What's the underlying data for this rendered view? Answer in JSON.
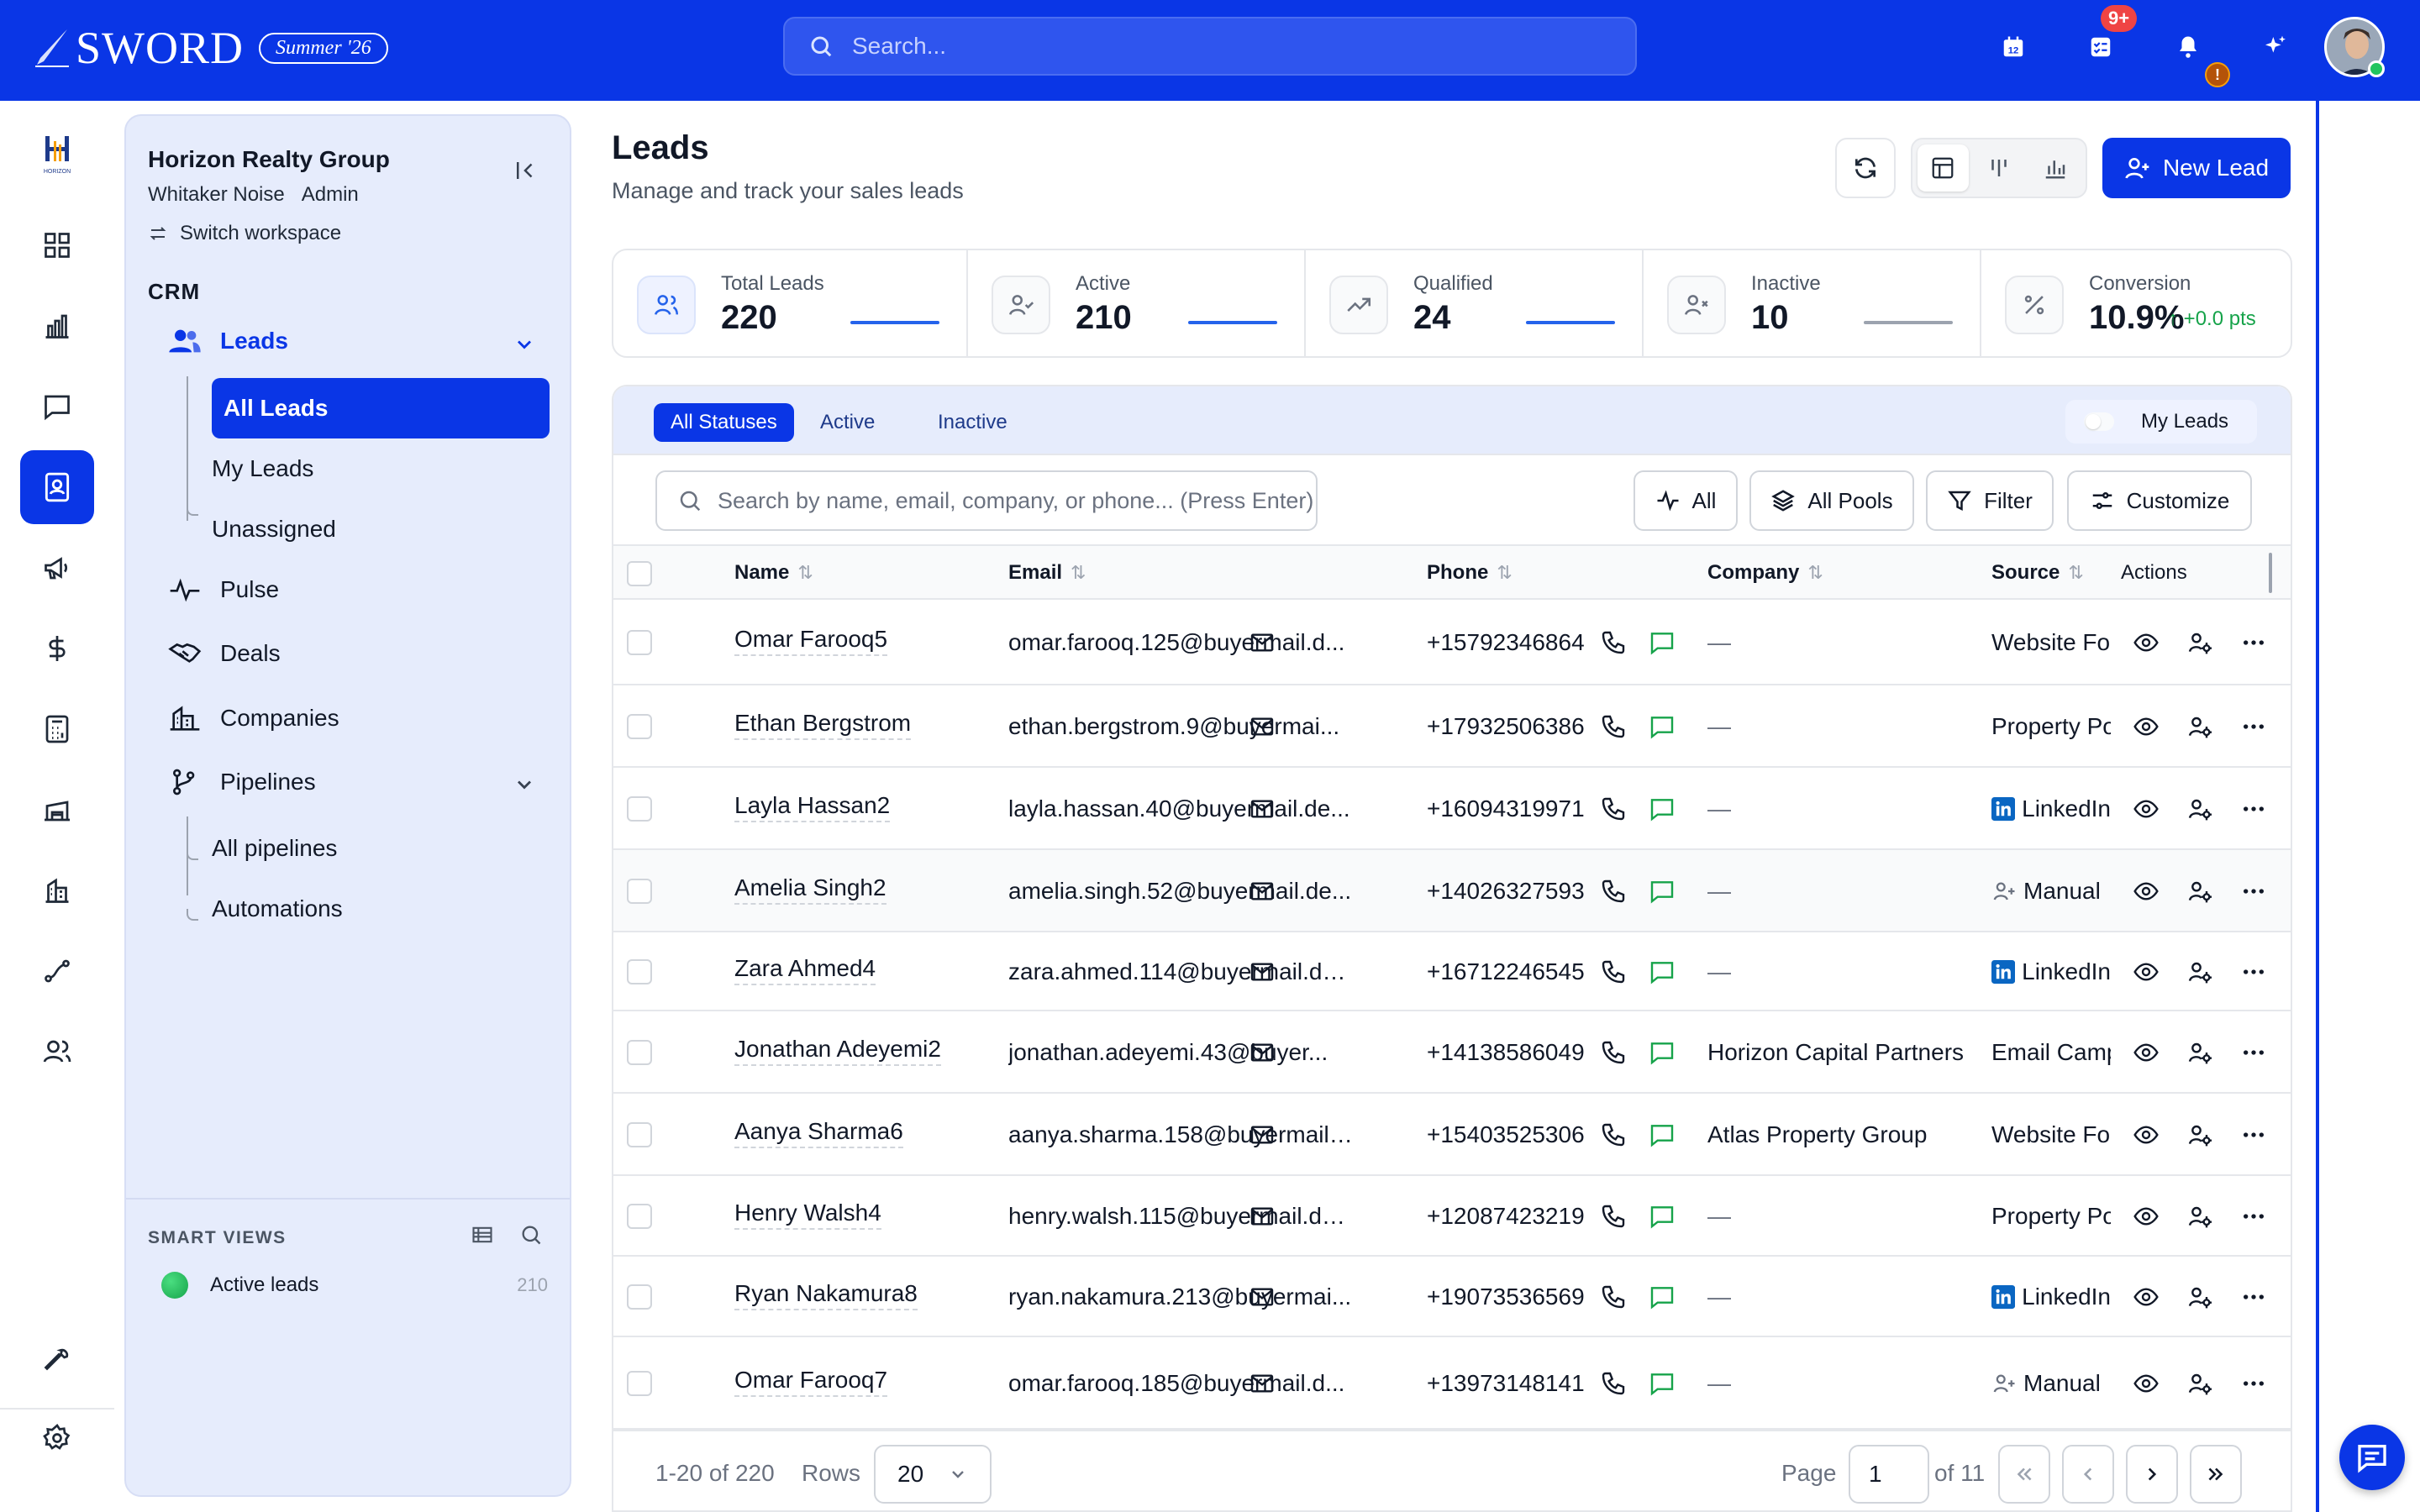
{
  "app": {
    "brand": "SWORD",
    "season": "Summer '26",
    "search_placeholder": "Search...",
    "task_badge": "9+",
    "notif_badge": "!",
    "colors": {
      "primary": "#0a36e6",
      "sidebar": "#e6ecfc",
      "success": "#22c55e"
    }
  },
  "rail": {
    "logo_text": "HORIZON",
    "items": [
      "dashboard-icon",
      "analytics-icon",
      "messages-icon",
      "contacts-icon",
      "campaigns-icon",
      "billing-icon",
      "calculator-icon",
      "warehouse-icon",
      "buildings-icon",
      "routes-icon",
      "team-icon",
      "tools-icon",
      "settings-icon"
    ]
  },
  "sidebar": {
    "workspace_name": "Horizon Realty Group",
    "user": "Whitaker Noise",
    "role": "Admin",
    "switch_label": "Switch workspace",
    "section": "CRM",
    "leads": "Leads",
    "all_leads": "All Leads",
    "my_leads": "My Leads",
    "unassigned": "Unassigned",
    "pulse": "Pulse",
    "deals": "Deals",
    "companies": "Companies",
    "pipelines": "Pipelines",
    "all_pipelines": "All pipelines",
    "automations": "Automations",
    "smart_views_title": "SMART VIEWS",
    "smart_view_name": "Active leads",
    "smart_view_count": "210"
  },
  "header": {
    "title": "Leads",
    "subtitle": "Manage and track your sales leads",
    "new_lead": "New Lead"
  },
  "stats": [
    {
      "label": "Total Leads",
      "value": "220"
    },
    {
      "label": "Active",
      "value": "210"
    },
    {
      "label": "Qualified",
      "value": "24"
    },
    {
      "label": "Inactive",
      "value": "10"
    },
    {
      "label": "Conversion",
      "value": "10.9%",
      "trend": "+0.0 pts"
    }
  ],
  "tabs": {
    "all": "All Statuses",
    "active": "Active",
    "inactive": "Inactive",
    "my_leads": "My Leads"
  },
  "toolbar": {
    "search_placeholder": "Search by name, email, company, or phone... (Press Enter)",
    "pulse_filter": "All",
    "pools": "All Pools",
    "filter": "Filter",
    "customize": "Customize"
  },
  "table": {
    "headers": {
      "name": "Name",
      "email": "Email",
      "phone": "Phone",
      "company": "Company",
      "source": "Source",
      "actions": "Actions"
    },
    "rows": [
      {
        "name": "Omar Farooq5",
        "email": "omar.farooq.125@buyermail.d...",
        "phone": "+15792346864",
        "company": "—",
        "source": "Website Form",
        "source_icon": ""
      },
      {
        "name": "Ethan Bergstrom",
        "email": "ethan.bergstrom.9@buyermai...",
        "phone": "+17932506386",
        "company": "—",
        "source": "Property Portal",
        "source_icon": ""
      },
      {
        "name": "Layla Hassan2",
        "email": "layla.hassan.40@buyermail.de...",
        "phone": "+16094319971",
        "company": "—",
        "source": "LinkedIn",
        "source_icon": "linkedin"
      },
      {
        "name": "Amelia Singh2",
        "email": "amelia.singh.52@buyermail.de...",
        "phone": "+14026327593",
        "company": "—",
        "source": "Manual",
        "source_icon": "manual"
      },
      {
        "name": "Zara Ahmed4",
        "email": "zara.ahmed.114@buyermail.de...",
        "phone": "+16712246545",
        "company": "—",
        "source": "LinkedIn",
        "source_icon": "linkedin"
      },
      {
        "name": "Jonathan Adeyemi2",
        "email": "jonathan.adeyemi.43@buyer...",
        "phone": "+14138586049",
        "company": "Horizon Capital Partners",
        "source": "Email Campaign",
        "source_icon": ""
      },
      {
        "name": "Aanya Sharma6",
        "email": "aanya.sharma.158@buyermail....",
        "phone": "+15403525306",
        "company": "Atlas Property Group",
        "source": "Website Form",
        "source_icon": ""
      },
      {
        "name": "Henry Walsh4",
        "email": "henry.walsh.115@buyermail.de...",
        "phone": "+12087423219",
        "company": "—",
        "source": "Property Portal",
        "source_icon": ""
      },
      {
        "name": "Ryan Nakamura8",
        "email": "ryan.nakamura.213@buyermai...",
        "phone": "+19073536569",
        "company": "—",
        "source": "LinkedIn",
        "source_icon": "linkedin"
      },
      {
        "name": "Omar Farooq7",
        "email": "omar.farooq.185@buyermail.d...",
        "phone": "+13973148141",
        "company": "—",
        "source": "Manual",
        "source_icon": "manual"
      }
    ]
  },
  "footer": {
    "range": "1-20 of 220",
    "rows_label": "Rows",
    "rows_value": "20",
    "page_label": "Page",
    "page_value": "1",
    "of_pages": "of 11"
  }
}
